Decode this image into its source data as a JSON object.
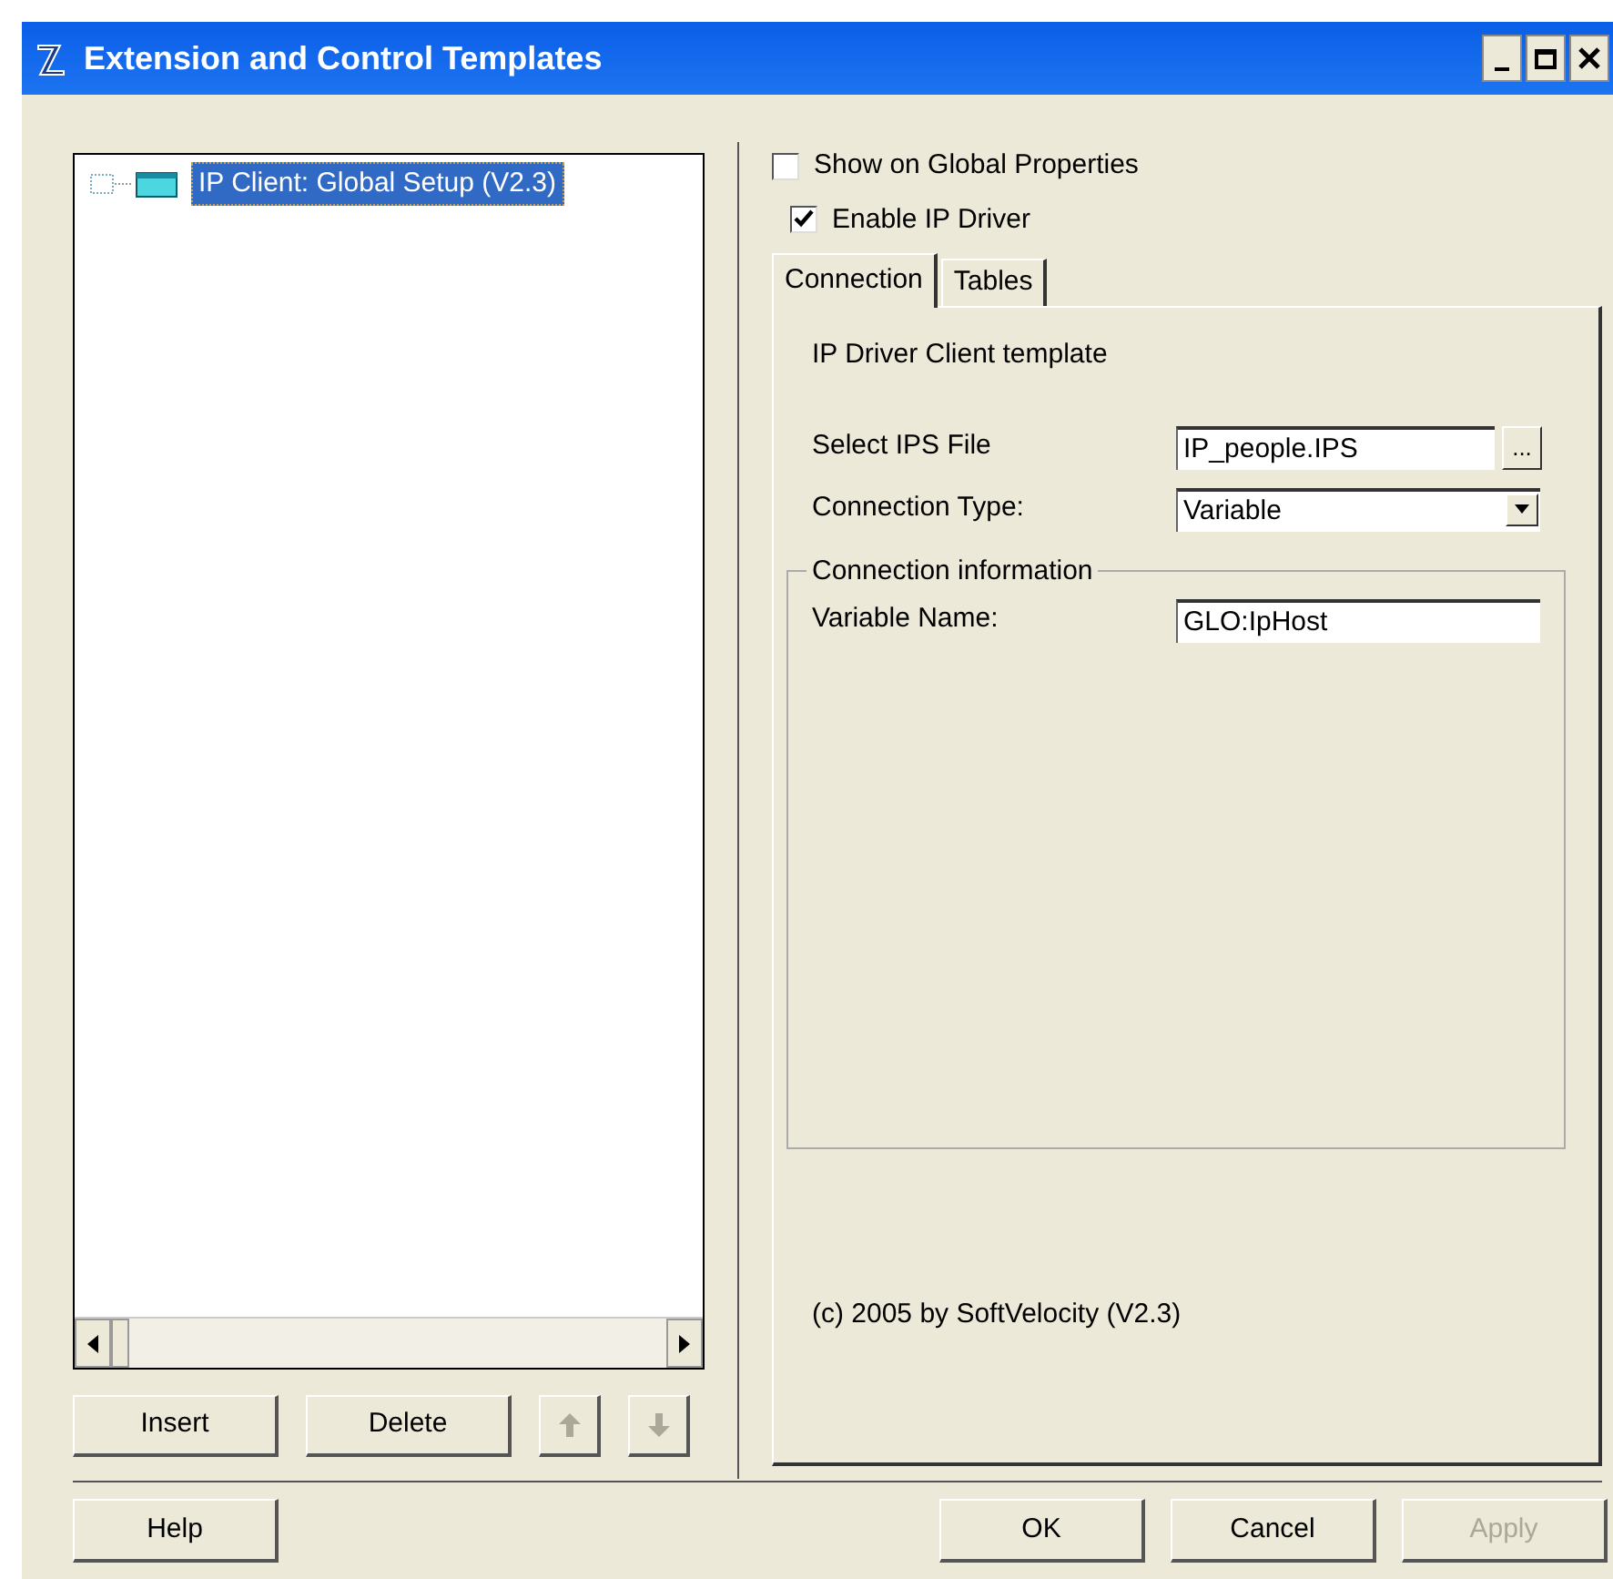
{
  "window": {
    "title": "Extension and Control Templates"
  },
  "tree": {
    "items": [
      {
        "label": "IP Client: Global Setup (V2.3)",
        "selected": true
      }
    ]
  },
  "list_buttons": [
    {
      "kind": "text",
      "label": "Insert",
      "disabled": false
    },
    {
      "kind": "text",
      "label": "Delete",
      "disabled": false
    },
    {
      "kind": "up",
      "disabled": true
    },
    {
      "kind": "down",
      "disabled": true
    }
  ],
  "options": [
    {
      "label": "Show on Global Properties",
      "checked": false
    },
    {
      "label": "Enable IP Driver",
      "checked": true
    }
  ],
  "tabs": [
    {
      "label": "Connection",
      "selected": true
    },
    {
      "label": "Tables",
      "selected": false
    }
  ],
  "panel": {
    "heading": "IP Driver Client template",
    "fields": [
      {
        "kind": "file",
        "label": "Select IPS File",
        "value": "IP_people.IPS",
        "button": "..."
      },
      {
        "kind": "select",
        "label": "Connection Type:",
        "value": "Variable"
      }
    ],
    "group": {
      "title": "Connection information",
      "fields": [
        {
          "kind": "text",
          "label": "Variable Name:",
          "value": "GLO:IpHost"
        }
      ]
    },
    "footer": "(c) 2005 by SoftVelocity (V2.3)"
  },
  "buttons": [
    {
      "label": "Help",
      "disabled": false
    },
    {
      "label": "OK",
      "disabled": false
    },
    {
      "label": "Cancel",
      "disabled": false
    },
    {
      "label": "Apply",
      "disabled": true
    }
  ]
}
